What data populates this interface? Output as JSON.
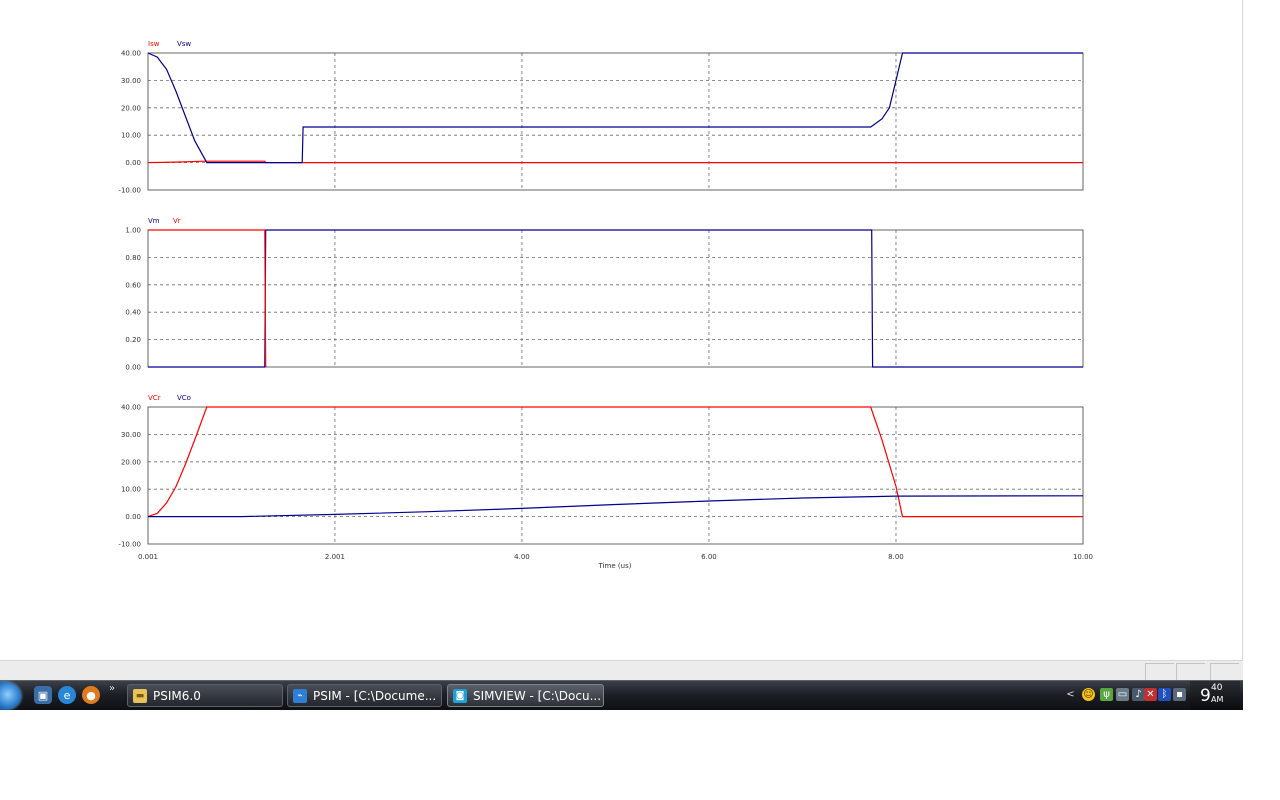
{
  "chart_data": [
    {
      "type": "line",
      "series": [
        {
          "name": "Isw",
          "color": "#ff0000",
          "points": [
            [
              0.001,
              0
            ],
            [
              0.3,
              0.2
            ],
            [
              0.6,
              0.5
            ],
            [
              1.25,
              0.5
            ],
            [
              1.26,
              0
            ],
            [
              10,
              0
            ]
          ]
        },
        {
          "name": "Vsw",
          "color": "#000090",
          "points": [
            [
              0.001,
              40
            ],
            [
              0.1,
              38.5
            ],
            [
              0.2,
              34
            ],
            [
              0.3,
              26
            ],
            [
              0.4,
              17
            ],
            [
              0.5,
              8
            ],
            [
              0.63,
              0
            ],
            [
              1.65,
              0
            ],
            [
              1.66,
              13
            ],
            [
              7.73,
              13
            ],
            [
              7.85,
              16
            ],
            [
              7.93,
              20
            ],
            [
              8.0,
              30
            ],
            [
              8.07,
              40
            ],
            [
              10,
              40
            ]
          ]
        }
      ],
      "xlim": [
        0.001,
        10
      ],
      "ylim": [
        -10,
        40
      ],
      "yticks": [
        "40.00",
        "30.00",
        "20.00",
        "10.00",
        "0.00",
        "-10.00"
      ],
      "grid": true,
      "legend_placement": "top-left"
    },
    {
      "type": "line",
      "series": [
        {
          "name": "Vm",
          "color": "#000090",
          "points": [
            [
              0.001,
              0
            ],
            [
              1.25,
              0
            ],
            [
              1.26,
              1
            ],
            [
              7.74,
              1
            ],
            [
              7.75,
              0
            ],
            [
              10,
              0
            ]
          ]
        },
        {
          "name": "Vr",
          "color": "#ff0000",
          "points": [
            [
              0.001,
              1
            ],
            [
              1.25,
              1
            ],
            [
              1.26,
              0
            ]
          ]
        }
      ],
      "xlim": [
        0.001,
        10
      ],
      "ylim": [
        0,
        1
      ],
      "yticks": [
        "1.00",
        "0.80",
        "0.60",
        "0.40",
        "0.20",
        "0.00"
      ],
      "grid": true,
      "legend_placement": "top-left"
    },
    {
      "type": "line",
      "series": [
        {
          "name": "VCr",
          "color": "#ff0000",
          "points": [
            [
              0.001,
              0
            ],
            [
              0.1,
              1.2
            ],
            [
              0.2,
              5
            ],
            [
              0.3,
              11
            ],
            [
              0.4,
              19
            ],
            [
              0.5,
              28
            ],
            [
              0.63,
              40
            ],
            [
              7.73,
              40
            ],
            [
              7.85,
              28
            ],
            [
              8.0,
              11
            ],
            [
              8.07,
              0
            ],
            [
              10,
              0
            ]
          ]
        },
        {
          "name": "VCo",
          "color": "#000090",
          "points": [
            [
              0.001,
              0
            ],
            [
              1.0,
              0
            ],
            [
              2.0,
              0.8
            ],
            [
              3.0,
              1.8
            ],
            [
              4.0,
              3.0
            ],
            [
              5.0,
              4.4
            ],
            [
              6.0,
              5.7
            ],
            [
              7.0,
              6.8
            ],
            [
              7.75,
              7.3
            ],
            [
              8.0,
              7.5
            ],
            [
              10,
              7.6
            ]
          ]
        }
      ],
      "xlim": [
        0.001,
        10
      ],
      "ylim": [
        -10,
        40
      ],
      "yticks": [
        "40.00",
        "30.00",
        "20.00",
        "10.00",
        "0.00",
        "-10.00"
      ],
      "xticks": [
        {
          "value": 0.001,
          "label": "0.001"
        },
        {
          "value": 2.0,
          "label": "2.001"
        },
        {
          "value": 4.0,
          "label": "4.00"
        },
        {
          "value": 6.0,
          "label": "6.00"
        },
        {
          "value": 8.0,
          "label": "8.00"
        },
        {
          "value": 10.0,
          "label": "10.00"
        }
      ],
      "xlabel": "Time (us)",
      "grid": true,
      "legend_placement": "top-left"
    }
  ],
  "taskbar": {
    "quicklaunch_more": "»",
    "tasks": [
      {
        "label": "PSIM6.0",
        "icon": "folder-icon"
      },
      {
        "label": "PSIM - [C:\\Docume...",
        "icon": "psim-icon"
      },
      {
        "label": "SIMVIEW - [C:\\Docu...",
        "icon": "simview-icon"
      }
    ],
    "tray_expand": "<",
    "clock": {
      "hour": "9",
      "minute": "40",
      "ampm": "AM"
    }
  }
}
